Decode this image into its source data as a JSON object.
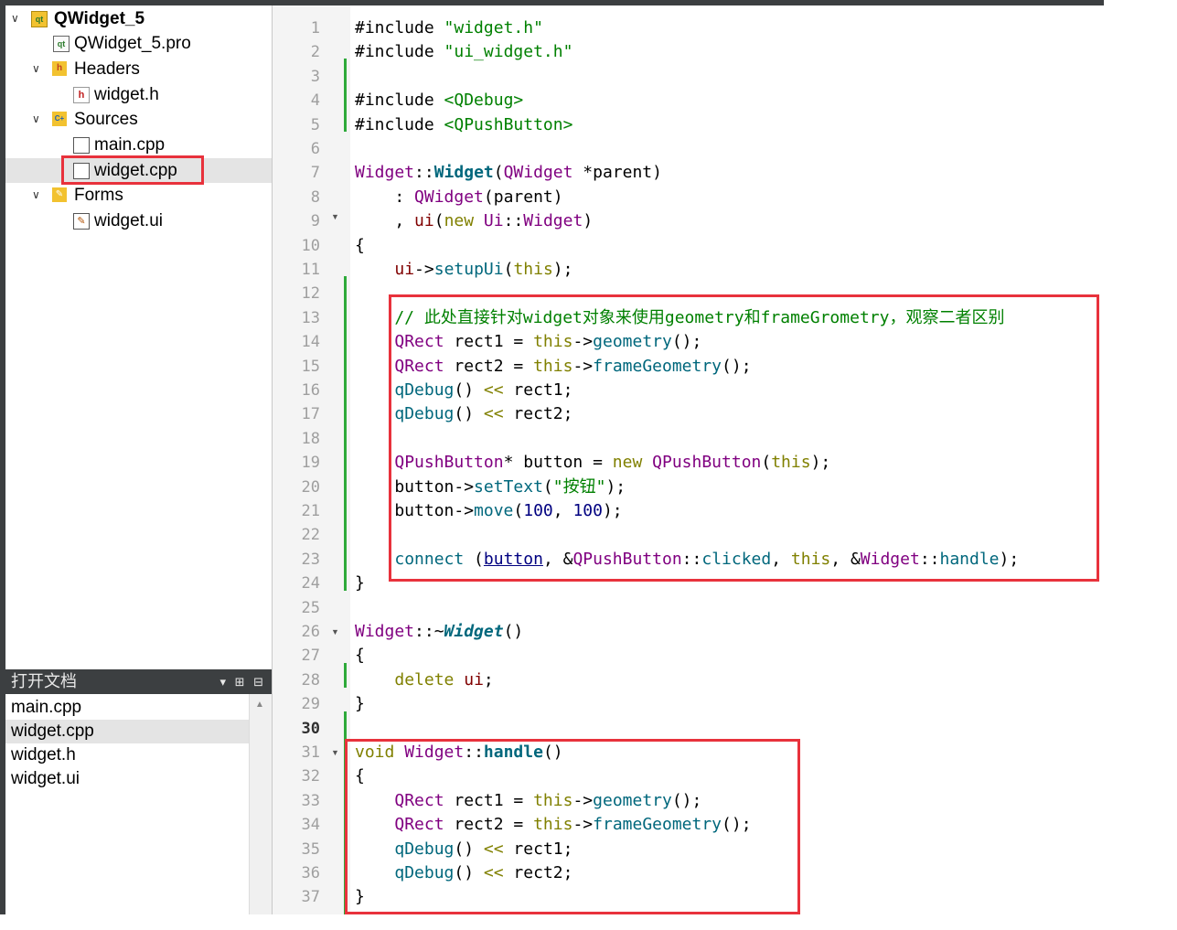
{
  "project_tree": {
    "project_name": "QWidget_5",
    "pro_file": "QWidget_5.pro",
    "headers_label": "Headers",
    "header_file": "widget.h",
    "sources_label": "Sources",
    "source_main": "main.cpp",
    "source_widget": "widget.cpp",
    "forms_label": "Forms",
    "form_file": "widget.ui"
  },
  "open_documents": {
    "title": "打开文档",
    "controls": "▾ ⊞ ⊟",
    "items": [
      "main.cpp",
      "widget.cpp",
      "widget.h",
      "widget.ui"
    ]
  },
  "editor": {
    "line_numbers": [
      "1",
      "2",
      "3",
      "4",
      "5",
      "6",
      "7",
      "8",
      "9",
      "10",
      "11",
      "12",
      "13",
      "14",
      "15",
      "16",
      "17",
      "18",
      "19",
      "20",
      "21",
      "22",
      "23",
      "24",
      "25",
      "26",
      "27",
      "28",
      "29",
      "30",
      "31",
      "32",
      "33",
      "34",
      "35",
      "36",
      "37"
    ],
    "lines": [
      [
        [
          "#include ",
          ""
        ],
        [
          "\"widget.h\"",
          "str"
        ]
      ],
      [
        [
          "#include ",
          ""
        ],
        [
          "\"ui_widget.h\"",
          "str"
        ]
      ],
      [],
      [
        [
          "#include ",
          ""
        ],
        [
          "<QDebug>",
          "str"
        ]
      ],
      [
        [
          "#include ",
          ""
        ],
        [
          "<QPushButton>",
          "str"
        ]
      ],
      [],
      [
        [
          "Widget",
          "ty"
        ],
        [
          "::",
          ""
        ],
        [
          "Widget",
          "fnb"
        ],
        [
          "(",
          ""
        ],
        [
          "QWidget",
          "ty"
        ],
        [
          " *parent)",
          ""
        ]
      ],
      [
        [
          "    : ",
          ""
        ],
        [
          "QWidget",
          "ty"
        ],
        [
          "(parent)",
          ""
        ]
      ],
      [
        [
          "    , ",
          ""
        ],
        [
          "ui",
          "mem"
        ],
        [
          "(",
          ""
        ],
        [
          "new",
          "kw"
        ],
        [
          " ",
          ""
        ],
        [
          "Ui",
          "ty"
        ],
        [
          "::",
          ""
        ],
        [
          "Widget",
          "ty"
        ],
        [
          ")",
          ""
        ]
      ],
      [
        [
          "{",
          ""
        ]
      ],
      [
        [
          "    ",
          ""
        ],
        [
          "ui",
          "mem"
        ],
        [
          "->",
          ""
        ],
        [
          "setupUi",
          "fn"
        ],
        [
          "(",
          ""
        ],
        [
          "this",
          "kw"
        ],
        [
          ");",
          ""
        ]
      ],
      [],
      [
        [
          "    // 此处直接针对widget对象来使用geometry和frameGrometry，观察二者区别",
          "cm"
        ]
      ],
      [
        [
          "    ",
          ""
        ],
        [
          "QRect",
          "ty"
        ],
        [
          " rect1 = ",
          ""
        ],
        [
          "this",
          "kw"
        ],
        [
          "->",
          ""
        ],
        [
          "geometry",
          "fn"
        ],
        [
          "();",
          ""
        ]
      ],
      [
        [
          "    ",
          ""
        ],
        [
          "QRect",
          "ty"
        ],
        [
          " rect2 = ",
          ""
        ],
        [
          "this",
          "kw"
        ],
        [
          "->",
          ""
        ],
        [
          "frameGeometry",
          "fn"
        ],
        [
          "();",
          ""
        ]
      ],
      [
        [
          "    ",
          ""
        ],
        [
          "qDebug",
          "fn"
        ],
        [
          "() ",
          ""
        ],
        [
          "<<",
          "kw"
        ],
        [
          " rect1;",
          ""
        ]
      ],
      [
        [
          "    ",
          ""
        ],
        [
          "qDebug",
          "fn"
        ],
        [
          "() ",
          ""
        ],
        [
          "<<",
          "kw"
        ],
        [
          " rect2;",
          ""
        ]
      ],
      [],
      [
        [
          "    ",
          ""
        ],
        [
          "QPushButton",
          "ty"
        ],
        [
          "* button = ",
          ""
        ],
        [
          "new",
          "kw"
        ],
        [
          " ",
          ""
        ],
        [
          "QPushButton",
          "ty"
        ],
        [
          "(",
          ""
        ],
        [
          "this",
          "kw"
        ],
        [
          ");",
          ""
        ]
      ],
      [
        [
          "    button->",
          ""
        ],
        [
          "setText",
          "fn"
        ],
        [
          "(",
          ""
        ],
        [
          "\"按钮\"",
          "str"
        ],
        [
          ");",
          ""
        ]
      ],
      [
        [
          "    button->",
          ""
        ],
        [
          "move",
          "fn"
        ],
        [
          "(",
          ""
        ],
        [
          "100",
          "num"
        ],
        [
          ", ",
          ""
        ],
        [
          "100",
          "num"
        ],
        [
          ");",
          ""
        ]
      ],
      [],
      [
        [
          "    ",
          ""
        ],
        [
          "connect",
          "fn"
        ],
        [
          " (",
          ""
        ],
        [
          "button",
          "lnk"
        ],
        [
          ", &",
          ""
        ],
        [
          "QPushButton",
          "ty"
        ],
        [
          "::",
          ""
        ],
        [
          "clicked",
          "fn"
        ],
        [
          ", ",
          ""
        ],
        [
          "this",
          "kw"
        ],
        [
          ", &",
          ""
        ],
        [
          "Widget",
          "ty"
        ],
        [
          "::",
          ""
        ],
        [
          "handle",
          "fn"
        ],
        [
          ");",
          ""
        ]
      ],
      [
        [
          "}",
          ""
        ]
      ],
      [],
      [
        [
          "Widget",
          "ty"
        ],
        [
          "::~",
          ""
        ],
        [
          "Widget",
          "fnbi"
        ],
        [
          "()",
          ""
        ]
      ],
      [
        [
          "{",
          ""
        ]
      ],
      [
        [
          "    ",
          ""
        ],
        [
          "delete",
          "kw"
        ],
        [
          " ",
          ""
        ],
        [
          "ui",
          "mem"
        ],
        [
          ";",
          ""
        ]
      ],
      [
        [
          "}",
          ""
        ]
      ],
      [],
      [
        [
          "void",
          "kw"
        ],
        [
          " ",
          ""
        ],
        [
          "Widget",
          "ty"
        ],
        [
          "::",
          ""
        ],
        [
          "handle",
          "fnb"
        ],
        [
          "()",
          ""
        ]
      ],
      [
        [
          "{",
          ""
        ]
      ],
      [
        [
          "    ",
          ""
        ],
        [
          "QRect",
          "ty"
        ],
        [
          " rect1 = ",
          ""
        ],
        [
          "this",
          "kw"
        ],
        [
          "->",
          ""
        ],
        [
          "geometry",
          "fn"
        ],
        [
          "();",
          ""
        ]
      ],
      [
        [
          "    ",
          ""
        ],
        [
          "QRect",
          "ty"
        ],
        [
          " rect2 = ",
          ""
        ],
        [
          "this",
          "kw"
        ],
        [
          "->",
          ""
        ],
        [
          "frameGeometry",
          "fn"
        ],
        [
          "();",
          ""
        ]
      ],
      [
        [
          "    ",
          ""
        ],
        [
          "qDebug",
          "fn"
        ],
        [
          "() ",
          ""
        ],
        [
          "<<",
          "kw"
        ],
        [
          " rect1;",
          ""
        ]
      ],
      [
        [
          "    ",
          ""
        ],
        [
          "qDebug",
          "fn"
        ],
        [
          "() ",
          ""
        ],
        [
          "<<",
          "kw"
        ],
        [
          " rect2;",
          ""
        ]
      ],
      [
        [
          "}",
          ""
        ]
      ]
    ]
  }
}
